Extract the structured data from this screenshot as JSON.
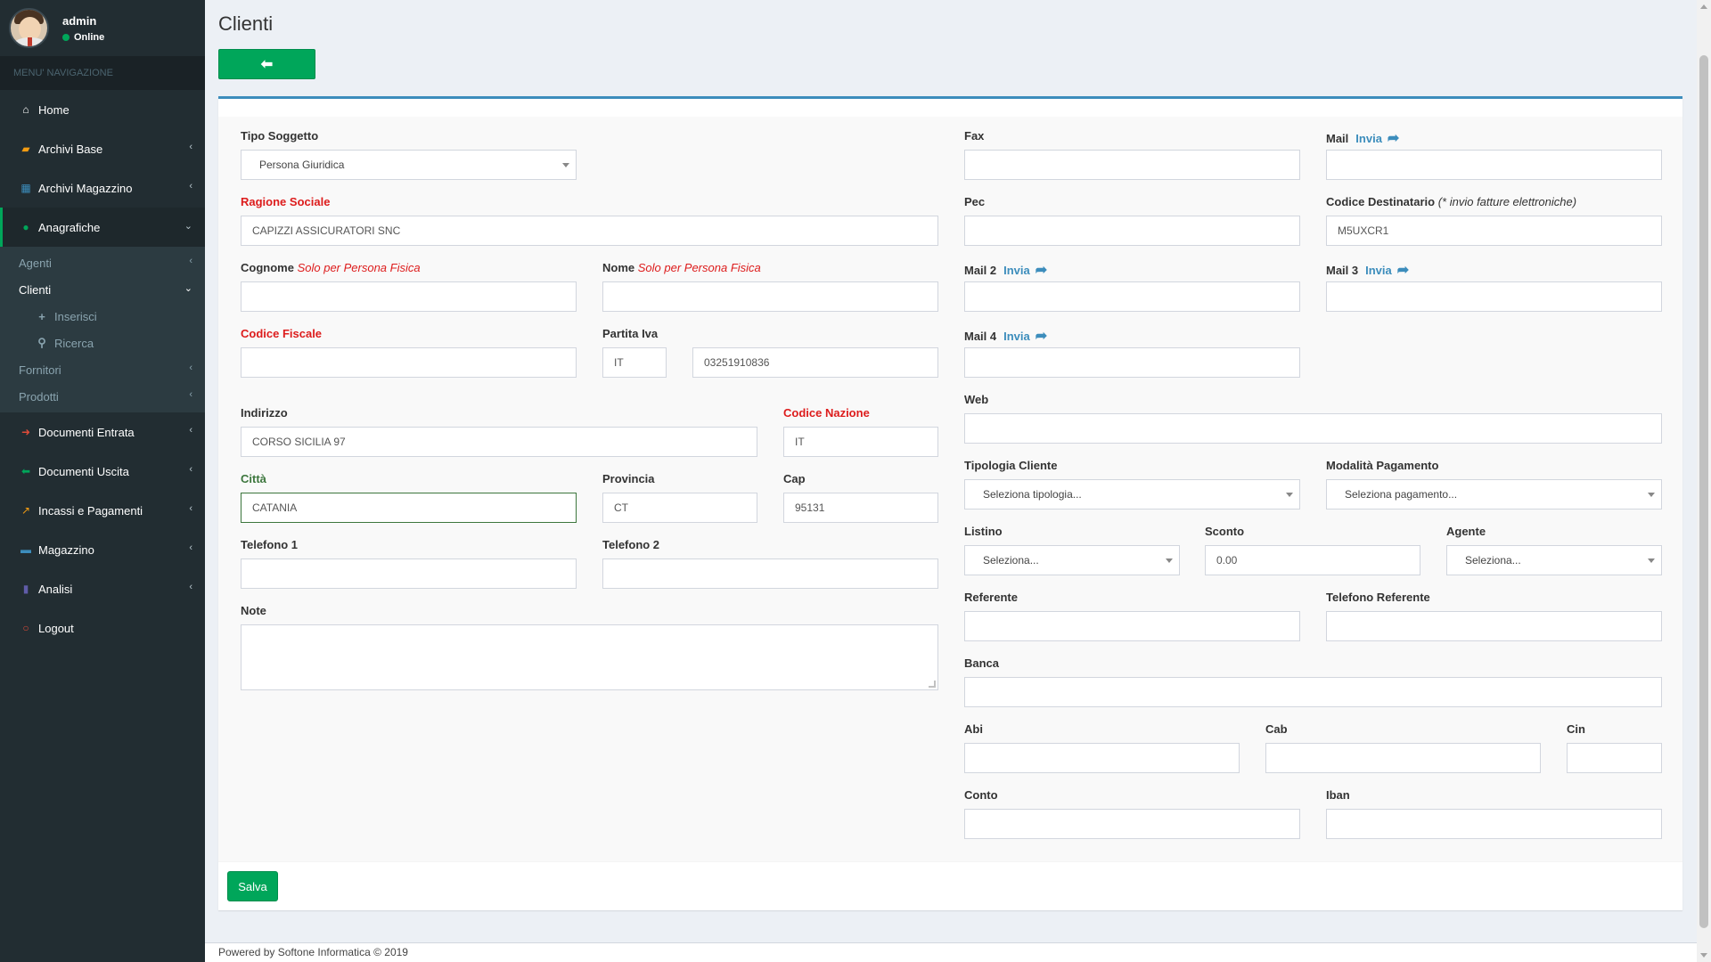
{
  "user": {
    "name": "admin",
    "status": "Online"
  },
  "menu_header": "MENU' NAVIGAZIONE",
  "menu": {
    "home": "Home",
    "archivi_base": "Archivi Base",
    "archivi_magazzino": "Archivi Magazzino",
    "anagrafiche": "Anagrafiche",
    "sub": {
      "agenti": "Agenti",
      "clienti": "Clienti",
      "inserisci": "Inserisci",
      "ricerca": "Ricerca",
      "fornitori": "Fornitori",
      "prodotti": "Prodotti"
    },
    "documenti_entrata": "Documenti Entrata",
    "documenti_uscita": "Documenti Uscita",
    "incassi": "Incassi e Pagamenti",
    "magazzino": "Magazzino",
    "analisi": "Analisi",
    "logout": "Logout"
  },
  "page": {
    "title": "Clienti",
    "back_icon": "arrow-left-icon"
  },
  "labels": {
    "tipo_soggetto": "Tipo Soggetto",
    "ragione_sociale": "Ragione Sociale",
    "cognome": "Cognome",
    "nome": "Nome",
    "solo_fisica": "Solo per Persona Fisica",
    "codice_fiscale": "Codice Fiscale",
    "partita_iva": "Partita Iva",
    "indirizzo": "Indirizzo",
    "codice_nazione": "Codice Nazione",
    "citta": "Città",
    "provincia": "Provincia",
    "cap": "Cap",
    "telefono1": "Telefono 1",
    "telefono2": "Telefono 2",
    "note": "Note",
    "fax": "Fax",
    "mail": "Mail",
    "invia": "Invia",
    "pec": "Pec",
    "codice_destinatario": "Codice Destinatario",
    "invio_fatture": "(* invio fatture elettroniche)",
    "mail2": "Mail 2",
    "mail3": "Mail 3",
    "mail4": "Mail 4",
    "web": "Web",
    "tipologia_cliente": "Tipologia Cliente",
    "modalita_pagamento": "Modalità Pagamento",
    "listino": "Listino",
    "sconto": "Sconto",
    "agente": "Agente",
    "referente": "Referente",
    "telefono_referente": "Telefono Referente",
    "banca": "Banca",
    "abi": "Abi",
    "cab": "Cab",
    "cin": "Cin",
    "conto": "Conto",
    "iban": "Iban"
  },
  "values": {
    "tipo_soggetto": "Persona Giuridica",
    "ragione_sociale": "CAPIZZI ASSICURATORI SNC",
    "cognome": "",
    "nome": "",
    "codice_fiscale": "",
    "piva_prefix": "IT",
    "partita_iva": "03251910836",
    "indirizzo": "CORSO SICILIA 97",
    "codice_nazione": "IT",
    "citta": "CATANIA",
    "provincia": "CT",
    "cap": "95131",
    "telefono1": "",
    "telefono2": "",
    "fax": "",
    "mail": "",
    "pec": "",
    "codice_destinatario": "M5UXCR1",
    "mail2": "",
    "mail3": "",
    "mail4": "",
    "web": "",
    "tipologia_cliente": "Seleziona tipologia...",
    "modalita_pagamento": "Seleziona pagamento...",
    "listino": "Seleziona...",
    "sconto": "0.00",
    "agente": "Seleziona...",
    "referente": "",
    "telefono_referente": "",
    "banca": "",
    "abi": "",
    "cab": "",
    "cin": "",
    "conto": "",
    "iban": ""
  },
  "buttons": {
    "save": "Salva"
  },
  "footer": "Powered by Softone Informatica © 2019",
  "colors": {
    "green": "#00a65a",
    "blue": "#3c8dbc",
    "sidebar": "#222d32",
    "red": "#dd1c1c"
  }
}
